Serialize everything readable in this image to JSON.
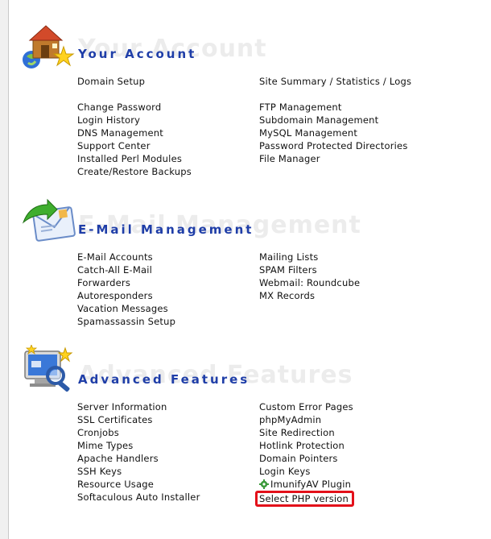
{
  "sections": [
    {
      "title": "Your Account",
      "left": [
        "Domain Setup",
        "",
        "Change Password",
        "Login History",
        "DNS Management",
        "Support Center",
        "Installed Perl Modules",
        "Create/Restore Backups"
      ],
      "right": [
        "Site Summary / Statistics / Logs",
        "",
        "FTP Management",
        "Subdomain Management",
        "MySQL Management",
        "Password Protected Directories",
        "File Manager"
      ]
    },
    {
      "title": "E-Mail Management",
      "left": [
        "E-Mail Accounts",
        "Catch-All E-Mail",
        "Forwarders",
        "Autoresponders",
        "Vacation Messages",
        "Spamassassin Setup"
      ],
      "right": [
        "Mailing Lists",
        "SPAM Filters",
        "Webmail: Roundcube",
        "MX Records"
      ]
    },
    {
      "title": "Advanced Features",
      "left": [
        "Server Information",
        "SSL Certificates",
        "Cronjobs",
        "Mime Types",
        "Apache Handlers",
        "SSH Keys",
        "Resource Usage",
        "Softaculous Auto Installer"
      ],
      "right": [
        "Custom Error Pages",
        "phpMyAdmin",
        "Site Redirection",
        "Hotlink Protection",
        "Domain Pointers",
        "Login Keys",
        "ImunifyAV Plugin",
        "Select PHP version"
      ]
    }
  ],
  "colors": {
    "title": "#1f3ea8",
    "highlight_border": "#e3101a"
  },
  "icons": [
    "house-account-icon",
    "email-envelope-icon",
    "computer-tools-icon",
    "gear-plugin-icon"
  ]
}
